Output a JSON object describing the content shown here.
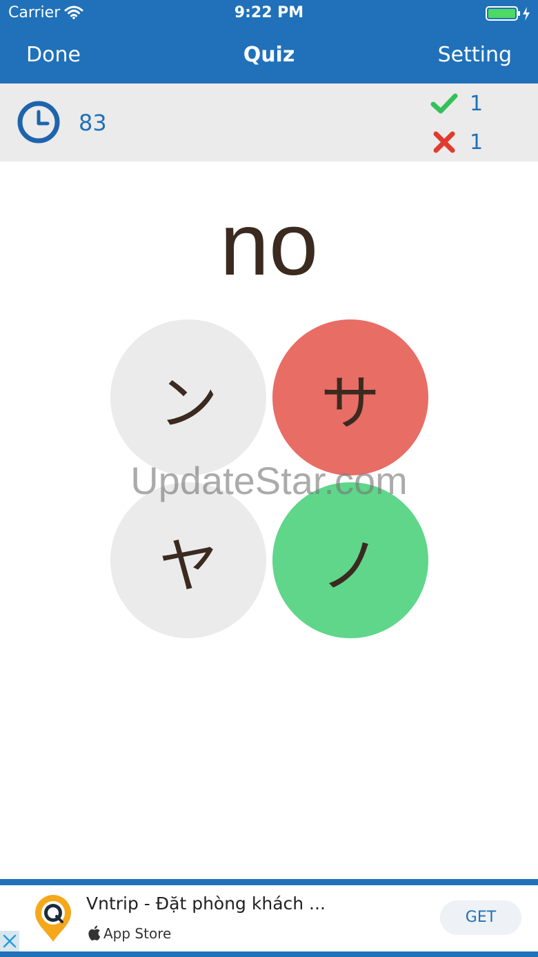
{
  "status_bar": {
    "carrier": "Carrier",
    "time": "9:22 PM",
    "icons": [
      "wifi-icon",
      "battery-icon",
      "charging-bolt-icon"
    ]
  },
  "nav": {
    "left_label": "Done",
    "title": "Quiz",
    "right_label": "Setting"
  },
  "info": {
    "timer_icon": "clock-icon",
    "timer_value": "83",
    "correct_icon": "checkmark-icon",
    "correct_count": "1",
    "wrong_icon": "cross-icon",
    "wrong_count": "1"
  },
  "question": {
    "romaji": "no"
  },
  "answers": [
    {
      "label": "ン",
      "state": "neutral"
    },
    {
      "label": "サ",
      "state": "wrong"
    },
    {
      "label": "ヤ",
      "state": "neutral"
    },
    {
      "label": "ノ",
      "state": "correct"
    }
  ],
  "watermark": "UpdateStar.com",
  "ad": {
    "title": "Vntrip - Đặt phòng khách ...",
    "store_label": "App Store",
    "button_label": "GET",
    "icons": [
      "vntrip-logo-icon",
      "apple-icon",
      "close-icon"
    ]
  },
  "colors": {
    "brand_blue": "#2071b9",
    "correct_green": "#5fd68a",
    "wrong_red": "#e86d65",
    "neutral_gray": "#ebebeb",
    "text_brown": "#3b2a20"
  }
}
